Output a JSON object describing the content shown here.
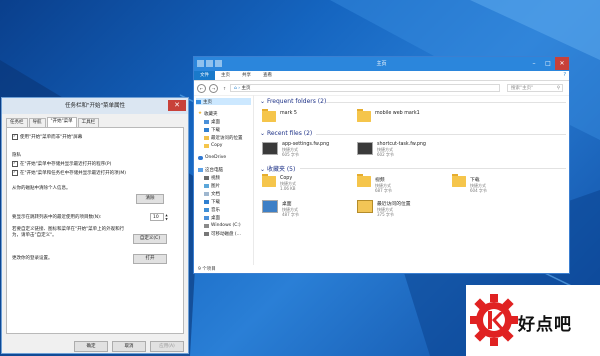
{
  "colors": {
    "accent": "#2b86dc",
    "file_tab": "#1979ca",
    "group_header": "#1e3287",
    "watermark_red": "#e02222"
  },
  "dialog": {
    "title": "任务栏和\"开始\"菜单属性",
    "close_icon": "close-icon",
    "tabs": [
      "任务栏",
      "导航",
      "\"开始\"菜单",
      "工具栏"
    ],
    "options": {
      "use_start_screen": "使用\"开始\"菜单而非\"开始\"屏幕",
      "privacy_title": "隐私",
      "store_recent_programs": "在\"开始\"菜单中存储并显示最近打开的程序(P)",
      "store_recent_items": "在\"开始\"菜单和任务栏中存储并显示最近打开的项(M)",
      "clear_desc": "从你的磁贴中清除个人信息。",
      "clear_button": "清除",
      "jumplist_label": "要显示在跳转列表中的最近使用的项目数(N):",
      "jumplist_value": "10",
      "customize_desc": "若要自定义链接、图标和菜单在\"开始\"菜单上的外观和行为，请单击\"自定义\"。",
      "customize_button": "自定义(C)",
      "change_desc": "更改你的登录设置。",
      "open_button": "打开"
    },
    "footer": {
      "ok": "确定",
      "cancel": "取消",
      "apply": "应用(A)"
    }
  },
  "explorer": {
    "title": "主页",
    "ribbon_tabs": [
      "文件",
      "主页",
      "共享",
      "查看"
    ],
    "address": "主页",
    "search_placeholder": "搜索\"主页\"",
    "nav": [
      {
        "label": "主页",
        "icon": "home-icon",
        "selected": true
      },
      {
        "label": "收藏夹",
        "icon": "star-icon"
      },
      {
        "label": "桌面",
        "icon": "desktop-icon"
      },
      {
        "label": "下载",
        "icon": "download-icon"
      },
      {
        "label": "最近访问的位置",
        "icon": "recent-icon"
      },
      {
        "label": "Copy",
        "icon": "folder-icon"
      },
      {
        "label": "OneDrive",
        "icon": "cloud-icon"
      },
      {
        "label": "这台电脑",
        "icon": "computer-icon"
      },
      {
        "label": "视频",
        "icon": "video-icon"
      },
      {
        "label": "图片",
        "icon": "pictures-icon"
      },
      {
        "label": "文档",
        "icon": "documents-icon"
      },
      {
        "label": "下载",
        "icon": "download-icon"
      },
      {
        "label": "音乐",
        "icon": "music-icon"
      },
      {
        "label": "桌面",
        "icon": "desktop-icon"
      },
      {
        "label": "Windows (C:)",
        "icon": "drive-icon"
      },
      {
        "label": "可移动磁盘 (...",
        "icon": "usb-drive-icon"
      }
    ],
    "frequent_header": "Frequent folders (2)",
    "frequent": [
      {
        "name": "mark 5",
        "icon": "folder-icon"
      },
      {
        "name": "mobile web mark1",
        "icon": "folder-icon"
      }
    ],
    "recent_header": "Recent files (2)",
    "recent": [
      {
        "name": "app-settings.fw.png",
        "sub1": "快捷方式",
        "sub2": "605 字节",
        "icon": "image-file-icon"
      },
      {
        "name": "shortcut-task.fw.png",
        "sub1": "快捷方式",
        "sub2": "602 字节",
        "icon": "image-file-icon"
      }
    ],
    "favorites_header": "收藏夹 (5)",
    "favorites": [
      {
        "name": "Copy",
        "sub1": "快捷方式",
        "sub2": "1.06 KB",
        "icon": "folder-icon"
      },
      {
        "name": "视频",
        "sub1": "快捷方式",
        "sub2": "687 字节",
        "icon": "folder-icon"
      },
      {
        "name": "下载",
        "sub1": "快捷方式",
        "sub2": "604 字节",
        "icon": "download-folder-icon"
      },
      {
        "name": "桌面",
        "sub1": "快捷方式",
        "sub2": "487 字节",
        "icon": "desktop-icon"
      },
      {
        "name": "最近访问的位置",
        "sub1": "快捷方式",
        "sub2": "375 字节",
        "icon": "recent-icon"
      }
    ],
    "status": "9 个项目"
  },
  "watermark": {
    "text": "好点吧"
  }
}
